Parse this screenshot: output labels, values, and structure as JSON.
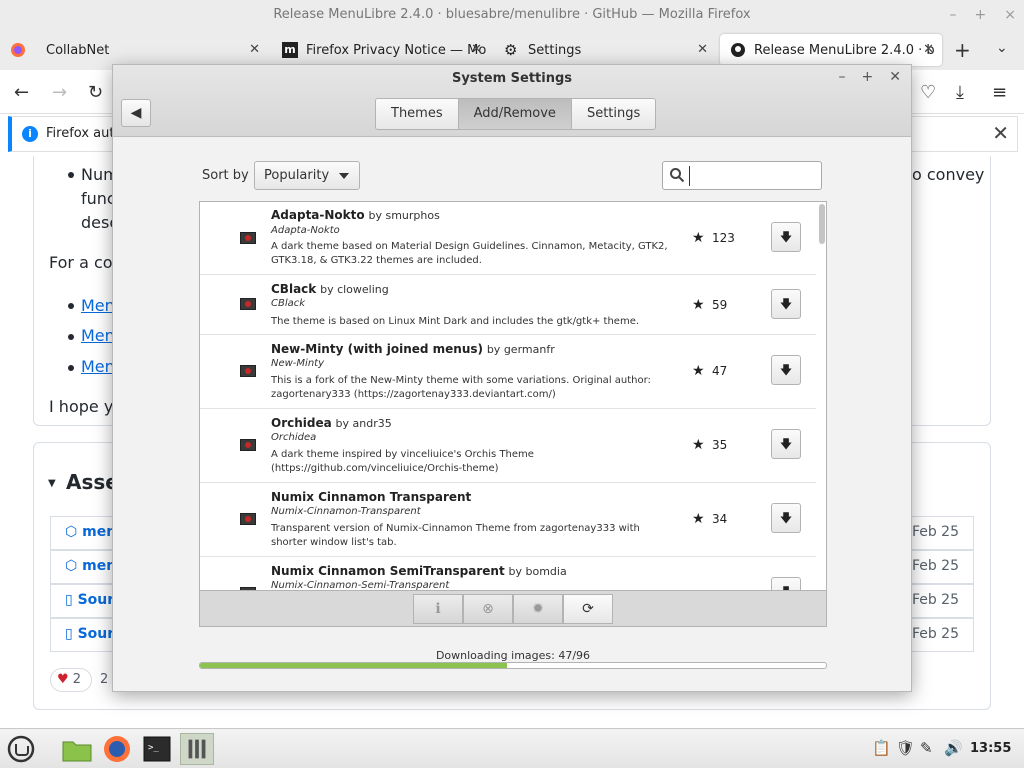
{
  "window_title": "Release MenuLibre 2.4.0 · bluesabre/menulibre · GitHub — Mozilla Firefox",
  "tabs": [
    {
      "label": "CollabNet"
    },
    {
      "label": "Firefox Privacy Notice — Mo"
    },
    {
      "label": "Settings"
    },
    {
      "label": "Release MenuLibre 2.4.0 · b"
    }
  ],
  "notification": {
    "text": "Firefox auto"
  },
  "page": {
    "line1_left": "Num",
    "line1_right": "o convey",
    "line2": "func",
    "line3": "desc",
    "for_a": "For a co",
    "links": [
      "Men",
      "Men",
      "Men"
    ],
    "hope": "I hope yo",
    "assets_title": "Asse",
    "assets": [
      {
        "name": "men",
        "date": "Feb 25"
      },
      {
        "name": "men",
        "date": "Feb 25"
      },
      {
        "name": "Sour",
        "date": "Feb 25"
      },
      {
        "name": "Sour",
        "date": "Feb 25"
      }
    ],
    "reaction_heart": "2",
    "reaction_count": "2"
  },
  "dialog": {
    "title": "System Settings",
    "segments": [
      {
        "label": "Themes",
        "active": false
      },
      {
        "label": "Add/Remove",
        "active": true
      },
      {
        "label": "Settings",
        "active": false
      }
    ],
    "sort_label": "Sort by",
    "sort_value": "Popularity",
    "search_value": "",
    "themes": [
      {
        "name": "Adapta-Nokto",
        "author": "by smurphos",
        "id": "Adapta-Nokto",
        "desc": "A dark theme based on Material Design Guidelines. Cinnamon, Metacity, GTK2, GTK3.18, & GTK3.22 themes are included.",
        "score": "123"
      },
      {
        "name": "CBlack",
        "author": "by cloweling",
        "id": "CBlack",
        "desc": "The theme is based on Linux Mint Dark and includes the gtk/gtk+ theme.",
        "score": "59"
      },
      {
        "name": "New-Minty (with joined menus)",
        "author": "by germanfr",
        "id": "New-Minty",
        "desc": "This is a fork of the New-Minty theme with some variations. Original author: zagortenary333 (https://zagortenay333.deviantart.com/)",
        "score": "47"
      },
      {
        "name": "Orchidea",
        "author": "by andr35",
        "id": "Orchidea",
        "desc": "A dark theme inspired by vinceliuice's Orchis Theme (https://github.com/vinceliuice/Orchis-theme)",
        "score": "35"
      },
      {
        "name": "Numix Cinnamon Transparent",
        "author": "",
        "id": "Numix-Cinnamon-Transparent",
        "desc": "Transparent version of Numix-Cinnamon Theme from zagortenay333 with shorter window list's tab.",
        "score": "34"
      },
      {
        "name": "Numix Cinnamon SemiTransparent",
        "author": "by bomdia",
        "id": "Numix-Cinnamon-Semi-Transparent",
        "desc": "",
        "score": ""
      }
    ],
    "progress_label": "Downloading images: 47/96",
    "progress_fraction": 0.49
  },
  "taskbar": {
    "clock": "13:55"
  }
}
